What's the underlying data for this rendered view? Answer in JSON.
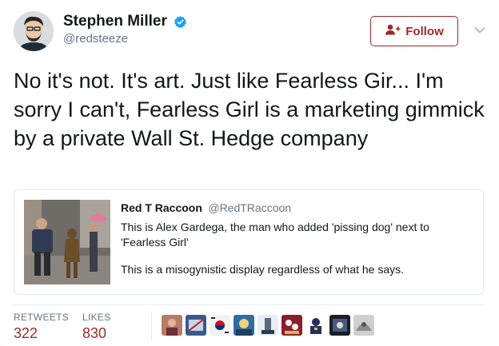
{
  "author": {
    "display_name": "Stephen Miller",
    "handle": "@redsteeze",
    "verified": true,
    "verified_color": "#1da1f2"
  },
  "follow_button": {
    "label": "Follow",
    "color": "#9c2b2b"
  },
  "tweet": {
    "text": "No it's not. It's art. Just like Fearless Gir... I'm sorry I can't, Fearless Girl is a marketing gimmick by a private Wall St. Hedge company"
  },
  "quoted_tweet": {
    "display_name": "Red T Raccoon",
    "handle": "@RedTRaccoon",
    "text_line1": "This is Alex Gardega, the man who added 'pissing dog' next to 'Fearless Girl'",
    "text_line2": "This is a misogynistic display regardless of what he says."
  },
  "stats": {
    "retweets_label": "RETWEETS",
    "retweets_value": "322",
    "likes_label": "LIKES",
    "likes_value": "830",
    "value_color": "#9c2b2b"
  },
  "likers_count_shown": 9
}
